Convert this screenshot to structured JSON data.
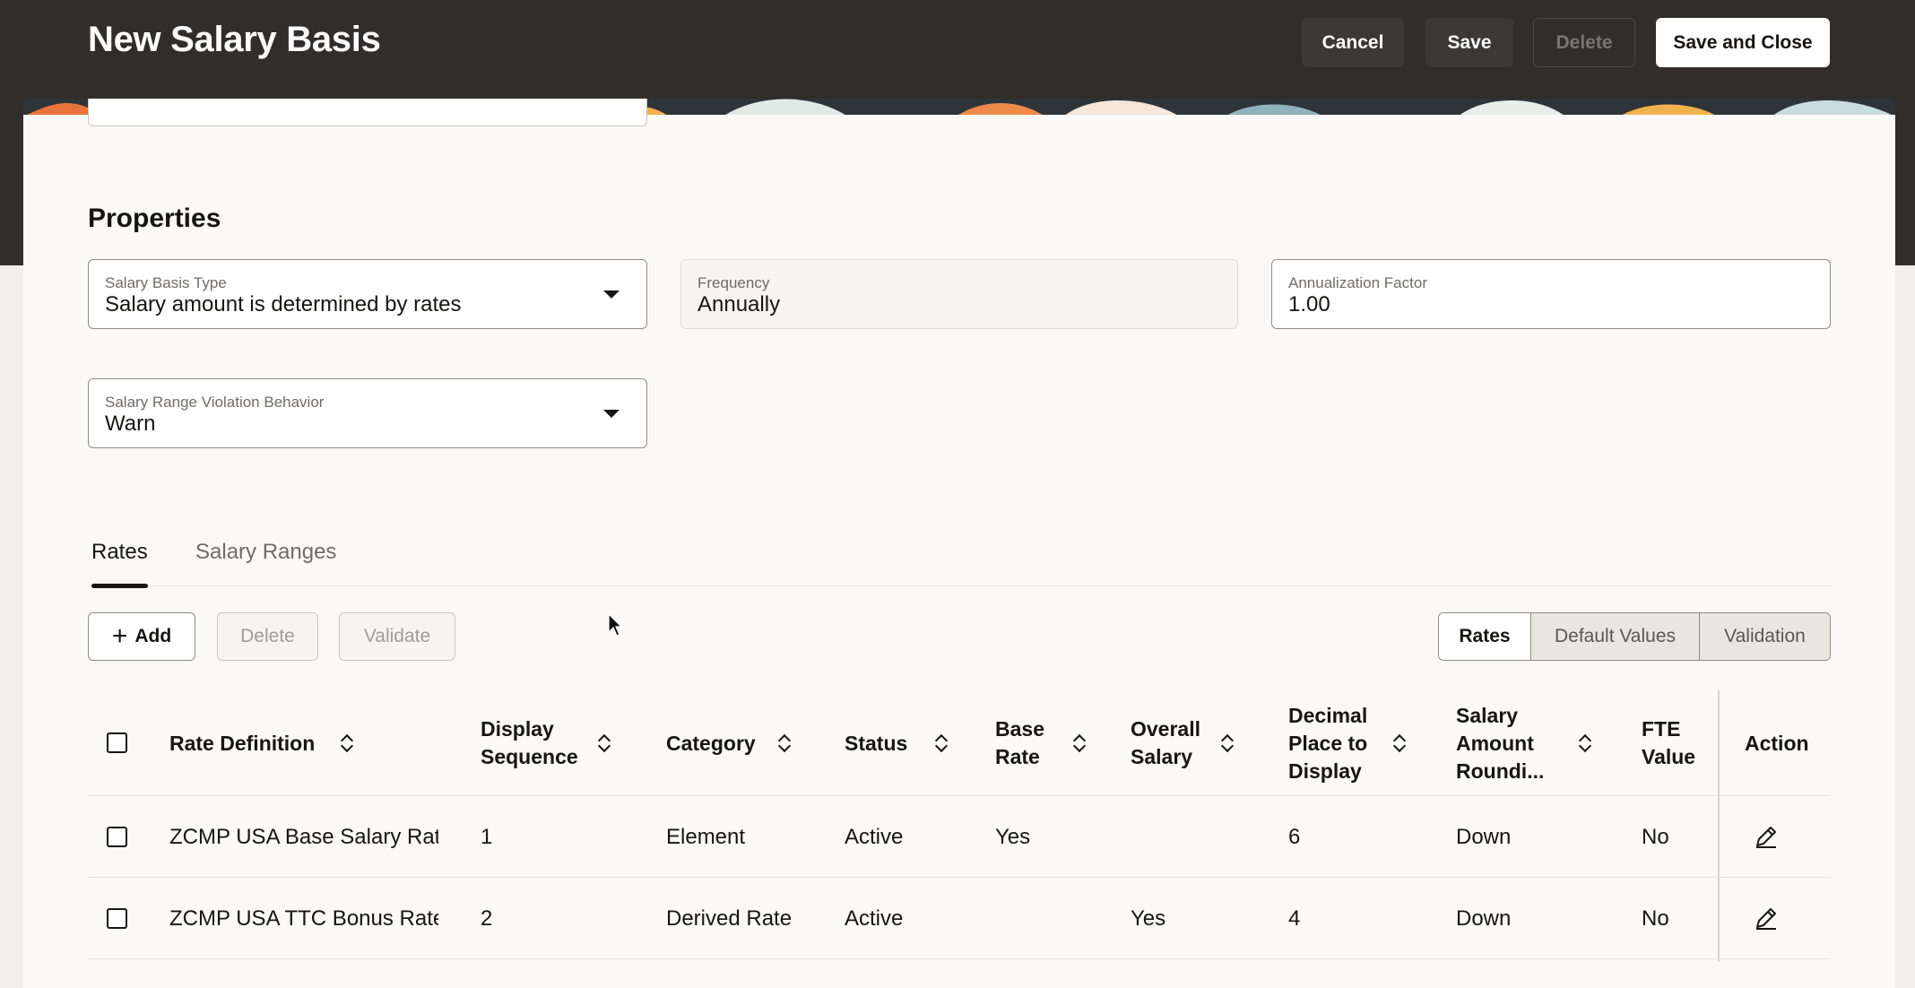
{
  "header": {
    "title": "New Salary Basis",
    "cancel_label": "Cancel",
    "save_label": "Save",
    "delete_label": "Delete",
    "save_close_label": "Save and Close"
  },
  "properties": {
    "section_title": "Properties",
    "salary_basis_type": {
      "label": "Salary Basis Type",
      "value": "Salary amount is determined by rates"
    },
    "frequency": {
      "label": "Frequency",
      "value": "Annually"
    },
    "annualization_factor": {
      "label": "Annualization Factor",
      "value": "1.00"
    },
    "range_violation": {
      "label": "Salary Range Violation Behavior",
      "value": "Warn"
    }
  },
  "tabs": [
    {
      "label": "Rates",
      "active": true
    },
    {
      "label": "Salary Ranges",
      "active": false
    }
  ],
  "toolbar": {
    "add_label": "Add",
    "delete_label": "Delete",
    "validate_label": "Validate"
  },
  "view_switch": [
    {
      "label": "Rates",
      "selected": true
    },
    {
      "label": "Default Values",
      "selected": false
    },
    {
      "label": "Validation",
      "selected": false
    }
  ],
  "table": {
    "columns": [
      "Rate Definition",
      "Display Sequence",
      "Category",
      "Status",
      "Base Rate",
      "Overall Salary",
      "Decimal Place to Display",
      "Salary Amount Roundi...",
      "FTE Value",
      "Action"
    ],
    "rows": [
      {
        "rate_definition": "ZCMP USA Base Salary Rate",
        "display_sequence": "1",
        "category": "Element",
        "status": "Active",
        "base_rate": "Yes",
        "overall_salary": "",
        "decimal_place": "6",
        "rounding": "Down",
        "fte_value": "No"
      },
      {
        "rate_definition": "ZCMP USA TTC Bonus Rate",
        "display_sequence": "2",
        "category": "Derived Rate",
        "status": "Active",
        "base_rate": "",
        "overall_salary": "Yes",
        "decimal_place": "4",
        "rounding": "Down",
        "fte_value": "No"
      }
    ]
  },
  "icons": {
    "add": "plus-icon",
    "caret": "chevron-down-icon",
    "sort": "sort-icon",
    "edit": "pencil-icon"
  }
}
